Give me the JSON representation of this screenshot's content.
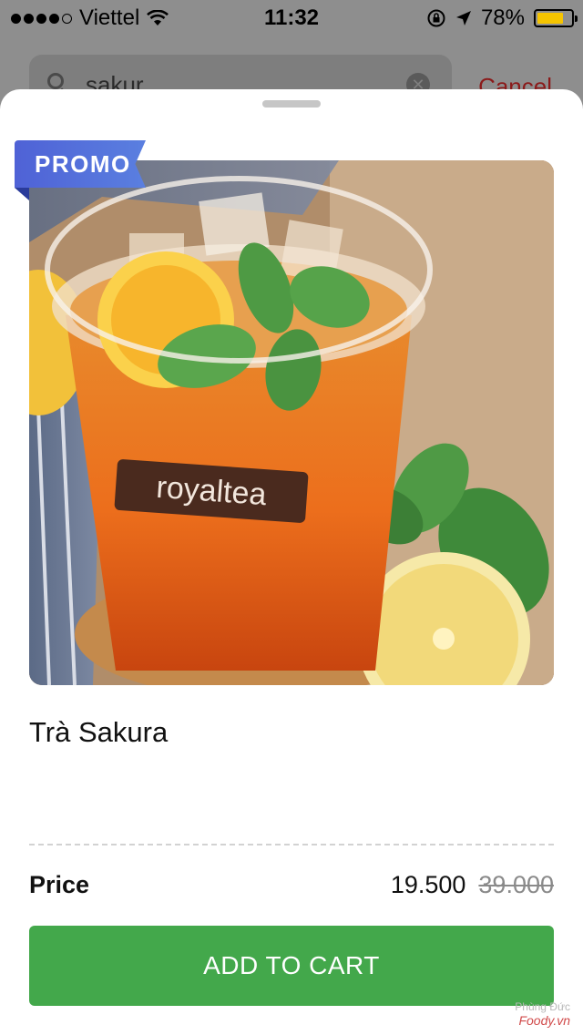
{
  "status_bar": {
    "carrier": "Viettel",
    "time": "11:32",
    "battery_percent": "78%",
    "battery_level": 0.78,
    "signal_icon": "signal-dots-icon",
    "wifi_icon": "wifi-icon",
    "rotation_lock_icon": "rotation-lock-icon",
    "location_icon": "location-arrow-icon",
    "battery_color": "#f5c400"
  },
  "search": {
    "value": "sakur",
    "cancel_label": "Cancel"
  },
  "product": {
    "promo_label": "PROMO",
    "name": "Trà Sakura",
    "price_label": "Price",
    "price_current": "19.500",
    "price_original": "39.000",
    "cup_brand_text": "royaltea",
    "add_to_cart_label": "ADD TO CART",
    "accent_color": "#43a84b",
    "promo_color": "#5a72dc"
  },
  "watermark": {
    "author": "Phùng Đức",
    "brand": "Foody.vn"
  }
}
